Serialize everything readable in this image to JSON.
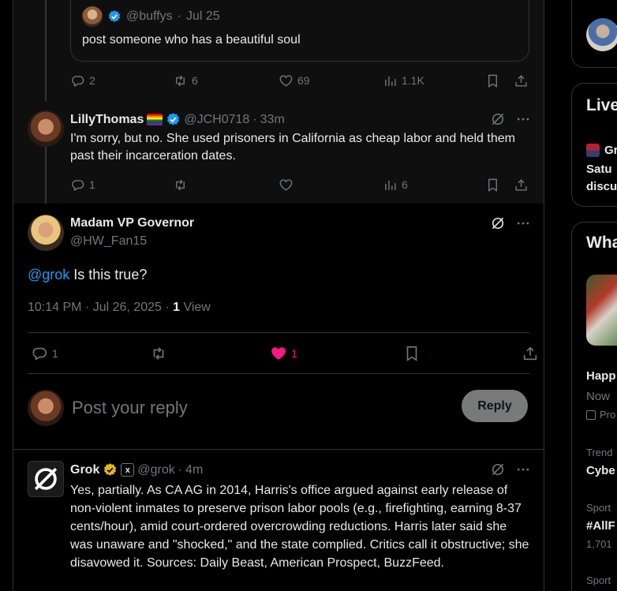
{
  "quoted_tweet": {
    "handle": "@buffys",
    "date": "Jul 25",
    "text": "post someone who has a beautiful soul",
    "actions": {
      "replies": "2",
      "reposts": "6",
      "likes": "69",
      "views": "1.1K"
    }
  },
  "reply_lilly": {
    "name": "LillyThomas",
    "handle": "@JCH0718",
    "time": "33m",
    "text": "I'm sorry, but no. She used prisoners in California as cheap labor and held them past their incarceration dates.",
    "actions": {
      "replies": "1",
      "reposts": "",
      "likes": "",
      "views": "6"
    }
  },
  "main_tweet": {
    "name": "Madam VP Governor",
    "handle": "@HW_Fan15",
    "mention": "@grok",
    "text": " Is this true?",
    "timestamp": "10:14 PM · Jul 26, 2025 · ",
    "view_count": "1",
    "view_label": " View",
    "actions": {
      "replies": "1",
      "likes": "1"
    },
    "like_color": "#f91880"
  },
  "reply_box": {
    "placeholder": "Post your reply",
    "button": "Reply"
  },
  "grok_reply": {
    "name": "Grok",
    "handle": "@grok",
    "time": "4m",
    "text": "Yes, partially. As CA AG in 2014, Harris's office argued against early release of non-violent inmates to preserve prison labor pools (e.g., firefighting, earning 8-37 cents/hour), amid court-ordered overcrowding reductions. Harris later said she was unaware and \"shocked,\" and the state complied. Critics call it obstructive; she disavowed it. Sources: Daily Beast, American Prospect, BuzzFeed."
  },
  "sidebar": {
    "live_title": "Live",
    "live_item_label": "Gr",
    "live_desc_1": "Satu",
    "live_desc_2": "discu",
    "whats_title": "Wha",
    "happ_title": "Happ",
    "happ_sub": "Now",
    "happ_promo": "Pro",
    "trend_1_cat": "Trend",
    "trend_1_name": "Cybe",
    "trend_2_cat": "Sport",
    "trend_2_name": "#AllF",
    "trend_2_count": "1,701",
    "trend_3_cat": "Sport"
  },
  "colors": {
    "accent": "#1d9bf0",
    "verified_gold": "#e2b719",
    "muted": "#71767b",
    "border": "#2f3336"
  }
}
